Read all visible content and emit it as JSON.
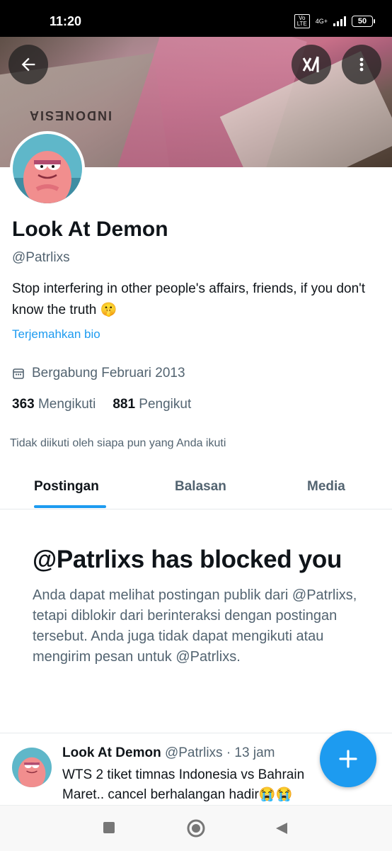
{
  "status_bar": {
    "time": "11:20",
    "volte": "Vo LTE",
    "network": "4G+",
    "battery": "50"
  },
  "header": {
    "back_icon": "arrow-left-icon",
    "grok_icon": "grok-icon",
    "more_icon": "more-vertical-icon",
    "banner_text": "INDONESIA"
  },
  "profile": {
    "name": "Look At Demon",
    "handle": "@Patrlixs",
    "bio": "Stop interfering in other people's affairs, friends, if you don't know the truth 🤫",
    "translate_link": "Terjemahkan bio",
    "joined": "Bergabung Februari 2013",
    "following_count": "363",
    "following_label": "Mengikuti",
    "followers_count": "881",
    "followers_label": "Pengikut",
    "not_followed_text": "Tidak diikuti oleh siapa pun yang Anda ikuti"
  },
  "tabs": [
    {
      "label": "Postingan",
      "active": true
    },
    {
      "label": "Balasan",
      "active": false
    },
    {
      "label": "Media",
      "active": false
    }
  ],
  "blocked": {
    "title": "@Patrlixs has blocked you",
    "message": "Anda dapat melihat postingan publik dari @Patrlixs, tetapi diblokir dari berinteraksi dengan postingan tersebut. Anda juga tidak dapat mengikuti atau mengirim pesan untuk @Patrlixs."
  },
  "post": {
    "name": "Look At Demon",
    "meta": "@Patrlixs · 13 jam",
    "text": "WTS 2 tiket timnas Indonesia vs Bahrain\nMaret.. cancel berhalangan hadir😭😭"
  },
  "fab_icon": "plus-icon",
  "nav": {
    "square_icon": "recents-square-icon",
    "home_icon": "home-circle-icon",
    "back_icon": "back-triangle-icon"
  },
  "colors": {
    "accent": "#1d9bf0",
    "text": "#0f1419",
    "secondary": "#536471"
  }
}
